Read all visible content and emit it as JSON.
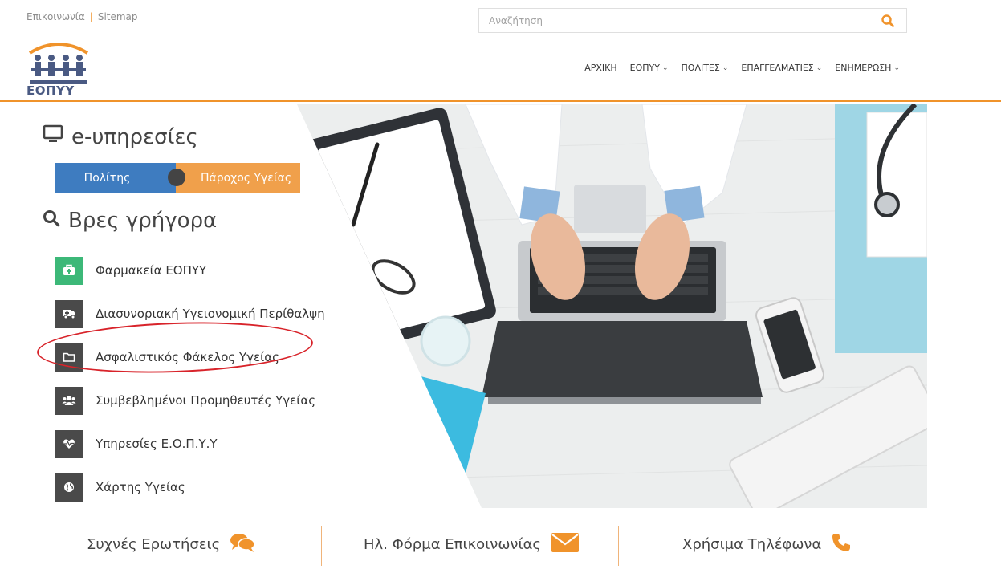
{
  "topbar": {
    "contact_label": "Επικοινωνία",
    "separator": "|",
    "sitemap_label": "Sitemap",
    "search_placeholder": "Αναζήτηση",
    "search_icon": "search-icon"
  },
  "header": {
    "logo_text": "ΕΟΠΥΥ",
    "nav": [
      {
        "label": "ΑΡΧΙΚΗ",
        "has_dropdown": false
      },
      {
        "label": "ΕΟΠΥΥ",
        "has_dropdown": true
      },
      {
        "label": "ΠΟΛΙΤΕΣ",
        "has_dropdown": true
      },
      {
        "label": "ΕΠΑΓΓΕΛΜΑΤΙΕΣ",
        "has_dropdown": true
      },
      {
        "label": "ΕΝΗΜΕΡΩΣΗ",
        "has_dropdown": true
      }
    ],
    "accent_color": "#f0932b"
  },
  "eservices": {
    "title": "e-υπηρεσίες",
    "icon": "monitor-icon",
    "toggle": {
      "citizen_label": "Πολίτης",
      "provider_label": "Πάροχος Υγείας",
      "citizen_color": "#3e7cc0",
      "provider_color": "#f0a04b"
    }
  },
  "quick_find": {
    "title": "Βρες γρήγορα",
    "icon": "search-icon",
    "items": [
      {
        "label": "Φαρμακεία ΕΟΠΥΥ",
        "icon": "medkit-icon",
        "color": "#3cb878"
      },
      {
        "label": "Διασυνοριακή Υγειονομική Περίθαλψη",
        "icon": "ambulance-icon",
        "color": "#4a4a4a"
      },
      {
        "label": "Ασφαλιστικός Φάκελος Υγείας",
        "icon": "folder-icon",
        "color": "#4a4a4a"
      },
      {
        "label": "Συμβεβλημένοι Προμηθευτές Υγείας",
        "icon": "users-icon",
        "color": "#4a4a4a"
      },
      {
        "label": "Υπηρεσίες Ε.Ο.Π.Υ.Υ",
        "icon": "heartbeat-icon",
        "color": "#4a4a4a"
      },
      {
        "label": "Χάρτης Υγείας",
        "icon": "globe-icon",
        "color": "#4a4a4a"
      }
    ]
  },
  "bottom": {
    "faq_label": "Συχνές Ερωτήσεις",
    "faq_icon": "chat-icon",
    "contact_form_label": "Ηλ. Φόρμα Επικοινωνίας",
    "contact_form_icon": "envelope-icon",
    "phones_label": "Χρήσιμα Τηλέφωνα",
    "phones_icon": "phone-icon",
    "icon_color": "#f0932b"
  }
}
